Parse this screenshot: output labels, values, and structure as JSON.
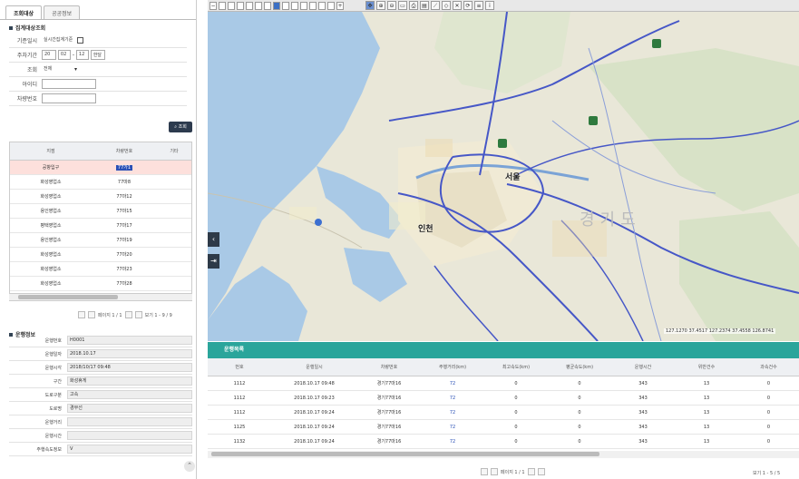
{
  "left_tabs": [
    "조회대상",
    "공공정보"
  ],
  "search_section": "집계대상조회",
  "form": {
    "start": {
      "label": "기준일시",
      "value": "실시간집계기준"
    },
    "date": {
      "label": "주차기간",
      "from": [
        "20",
        "02",
        "12"
      ],
      "to": "한달"
    },
    "type": {
      "label": "조회",
      "value": "전체"
    },
    "id": {
      "label": "아이디",
      "value": ""
    },
    "car": {
      "label": "차량번호",
      "value": ""
    }
  },
  "search_button": "조회",
  "grid": {
    "headers": [
      "지점",
      "차량번호",
      "기타"
    ],
    "rows": [
      [
        "공항입구",
        "77가1",
        ""
      ],
      [
        "화성영업소",
        "77마8",
        ""
      ],
      [
        "화성영업소",
        "77마12",
        ""
      ],
      [
        "용인영업소",
        "77마15",
        ""
      ],
      [
        "평택영업소",
        "77마17",
        ""
      ],
      [
        "용인영업소",
        "77마19",
        ""
      ],
      [
        "화성영업소",
        "77마20",
        ""
      ],
      [
        "화성영업소",
        "77마23",
        ""
      ],
      [
        "화성영업소",
        "77마28",
        ""
      ]
    ]
  },
  "grid_pager": "페이지 1 / 1",
  "grid_info": "보기 1 - 9 / 9",
  "detail_section": "운행정보",
  "detail": [
    {
      "label": "운행번호",
      "value": "H0001"
    },
    {
      "label": "운행일자",
      "value": "2018.10.17"
    },
    {
      "label": "운행시각",
      "value": "2018/10/17 09:48"
    },
    {
      "label": "구간",
      "value": "화성휴게"
    },
    {
      "label": "도로구분",
      "value": "고속"
    },
    {
      "label": "도로명",
      "value": "경부선"
    },
    {
      "label": "운행거리",
      "value": ""
    },
    {
      "label": "운행시간",
      "value": ""
    },
    {
      "label": "주행속도정보",
      "value": "V"
    }
  ],
  "map": {
    "labels": [
      "인천",
      "서울",
      "경기도"
    ],
    "info": "127.1270 37.4517 127.2374 37.4558 126.8741"
  },
  "panel_title": "운행목록",
  "table": {
    "headers": [
      "번호",
      "운행일시",
      "차량번호",
      "주행거리(km)",
      "최고속도(km)",
      "평균속도(km)",
      "운행시간",
      "위반건수",
      "과속건수"
    ],
    "rows": [
      [
        "1112",
        "2018.10.17 09:48",
        "경기77마16",
        "72",
        "0",
        "0",
        "343",
        "13",
        "0"
      ],
      [
        "1112",
        "2018.10.17 09:23",
        "경기77마16",
        "72",
        "0",
        "0",
        "343",
        "13",
        "0"
      ],
      [
        "1112",
        "2018.10.17 09:24",
        "경기77마16",
        "72",
        "0",
        "0",
        "343",
        "13",
        "0"
      ],
      [
        "1125",
        "2018.10.17 09:24",
        "경기77마16",
        "72",
        "0",
        "0",
        "343",
        "13",
        "0"
      ],
      [
        "1132",
        "2018.10.17 09:24",
        "경기77마16",
        "72",
        "0",
        "0",
        "343",
        "13",
        "0"
      ]
    ]
  },
  "table_pager": "페이지 1 / 1",
  "table_info": "보기 1 - 5 / 5"
}
